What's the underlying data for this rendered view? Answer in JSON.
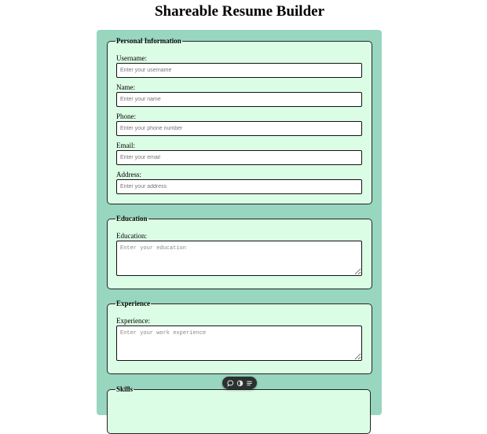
{
  "page": {
    "title": "Shareable Resume Builder"
  },
  "personal": {
    "legend": "Personal Information",
    "username_label": "Username:",
    "username_placeholder": "Enter your username",
    "name_label": "Name:",
    "name_placeholder": "Enter your name",
    "phone_label": "Phone:",
    "phone_placeholder": "Enter your phone number",
    "email_label": "Email:",
    "email_placeholder": "Enter your email",
    "address_label": "Address:",
    "address_placeholder": "Enter your address"
  },
  "education": {
    "legend": "Education",
    "label": "Education:",
    "placeholder": "Enter your education"
  },
  "experience": {
    "legend": "Experience",
    "label": "Experience:",
    "placeholder": "Enter your work experience"
  },
  "skills": {
    "legend": "Skills"
  },
  "toolbar": {
    "icons": [
      "comment-icon",
      "contrast-icon",
      "menu-icon"
    ]
  },
  "colors": {
    "panel": "#98d6c0",
    "fieldset": "#dcfde5",
    "toolbar": "#2a3230"
  }
}
